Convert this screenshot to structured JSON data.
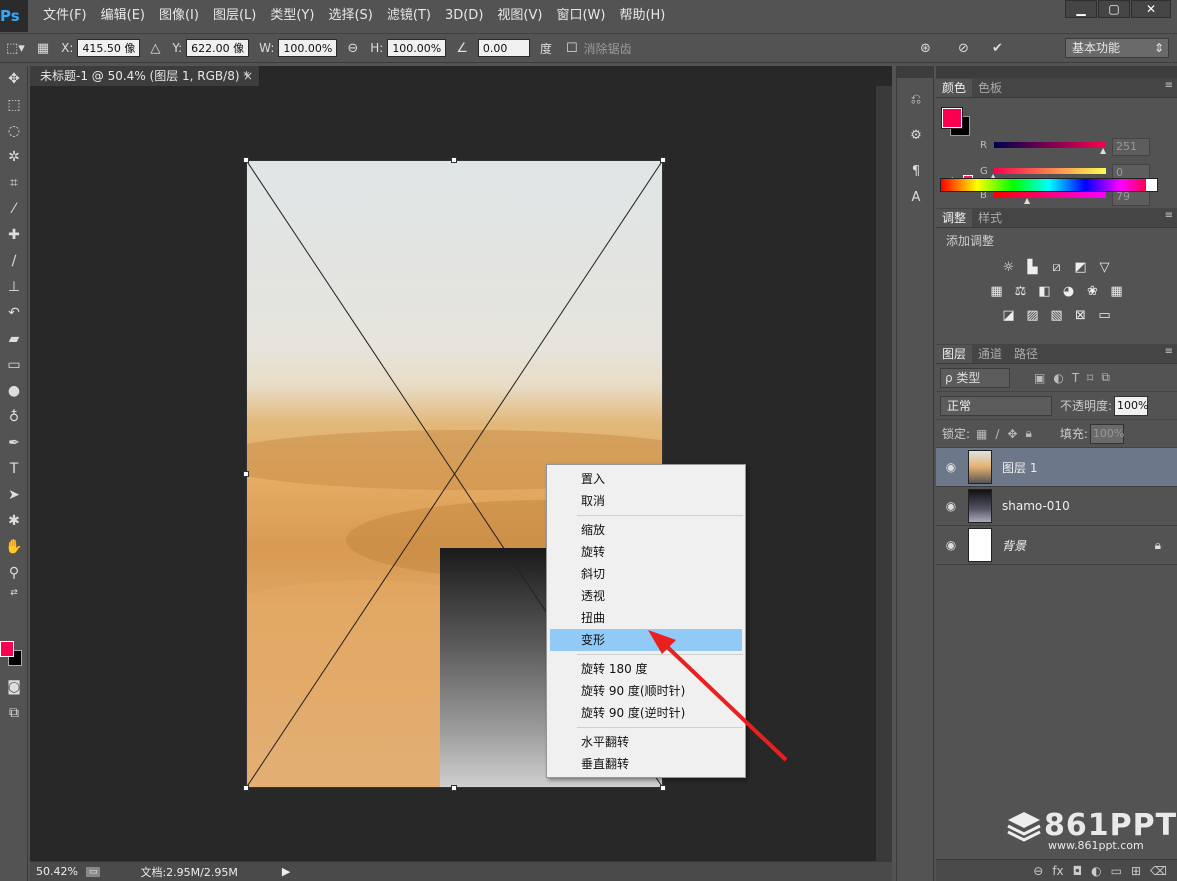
{
  "app": {
    "logo": "Ps"
  },
  "menu": [
    "文件(F)",
    "编辑(E)",
    "图像(I)",
    "图层(L)",
    "类型(Y)",
    "选择(S)",
    "滤镜(T)",
    "3D(D)",
    "视图(V)",
    "窗口(W)",
    "帮助(H)"
  ],
  "window_controls": {
    "minimize": "▁",
    "maximize": "▢",
    "close": "✕"
  },
  "options": {
    "x_label": "X:",
    "x_value": "415.50 像",
    "y_label": "Y:",
    "y_value": "622.00 像",
    "w_label": "W:",
    "w_value": "100.00%",
    "h_label": "H:",
    "h_value": "100.00%",
    "angle_value": "0.00",
    "angle_unit": "度",
    "antialias_label": "消除锯齿",
    "workspace": "基本功能"
  },
  "document": {
    "tab_title": "未标题-1 @ 50.4% (图层 1, RGB/8) *",
    "zoom": "50.42%",
    "doc_info": "文档:2.95M/2.95M"
  },
  "context_menu": {
    "items_group1": [
      "置入",
      "取消"
    ],
    "items_group2": [
      "缩放",
      "旋转",
      "斜切",
      "透视",
      "扭曲",
      "变形"
    ],
    "items_group3": [
      "旋转 180 度",
      "旋转 90 度(顺时针)",
      "旋转 90 度(逆时针)"
    ],
    "items_group4": [
      "水平翻转",
      "垂直翻转"
    ],
    "selected": "变形"
  },
  "color_panel": {
    "tabs": [
      "颜色",
      "色板"
    ],
    "r_label": "R",
    "r_value": "251",
    "g_label": "G",
    "g_value": "0",
    "b_label": "B",
    "b_value": "79",
    "foreground": "#fb0051"
  },
  "adjust_panel": {
    "tabs": [
      "调整",
      "样式"
    ],
    "title": "添加调整"
  },
  "layers_panel": {
    "tabs": [
      "图层",
      "通道",
      "路径"
    ],
    "filter": "ρ 类型",
    "blend_mode": "正常",
    "opacity_label": "不透明度:",
    "opacity_value": "100%",
    "lock_label": "锁定:",
    "fill_label": "填充:",
    "fill_value": "100%",
    "layers": [
      {
        "name": "图层 1"
      },
      {
        "name": "shamo-010"
      },
      {
        "name": "背景"
      }
    ]
  },
  "watermark": {
    "brand": "861PPT",
    "url": "www.861ppt.com"
  }
}
